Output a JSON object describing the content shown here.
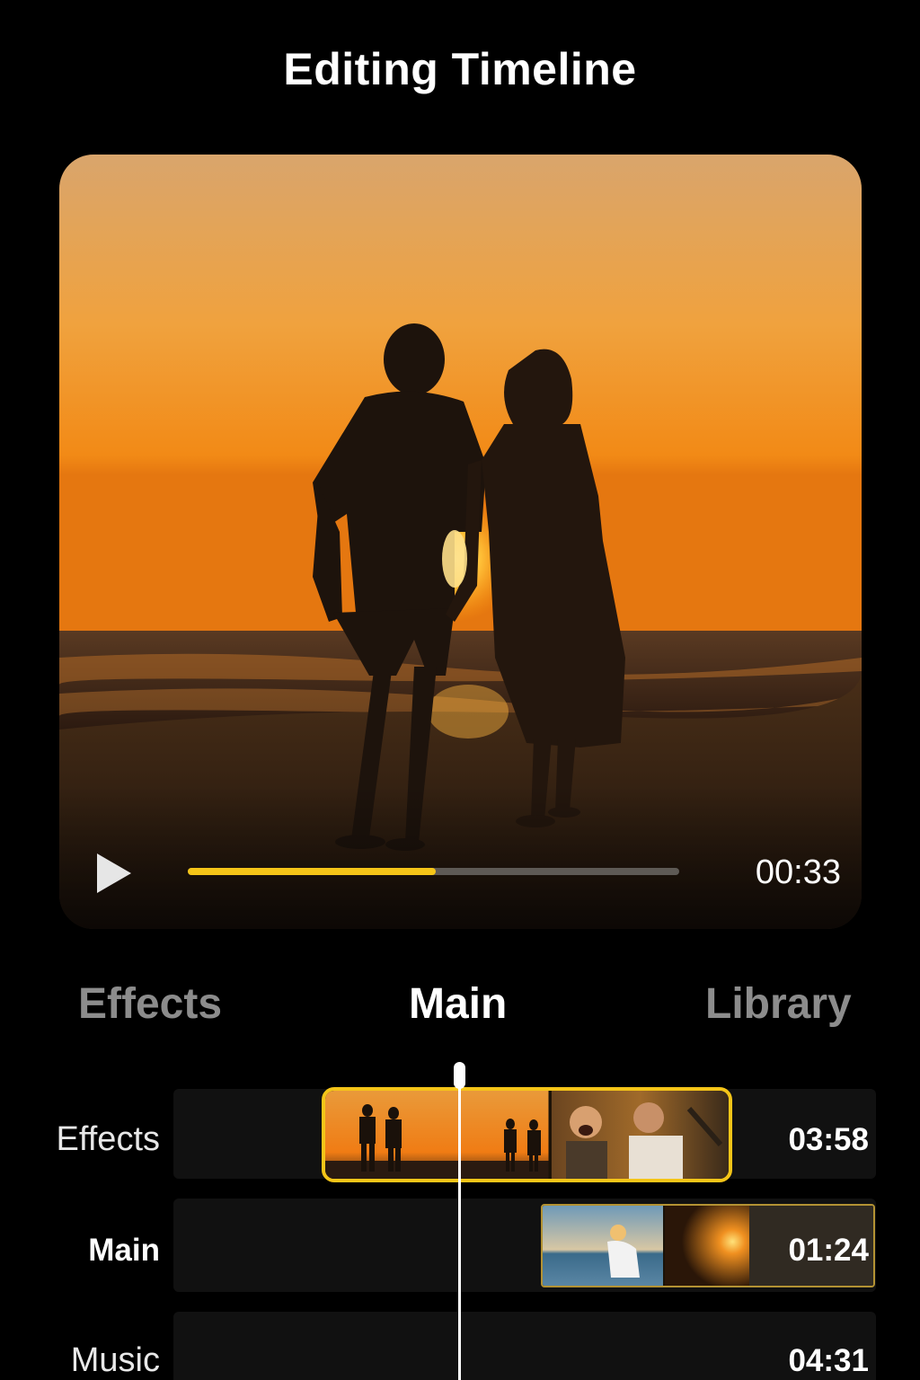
{
  "header": {
    "title": "Editing Timeline"
  },
  "player": {
    "current_time": "00:33",
    "progress": 0.505,
    "progress_color": "#f5c518"
  },
  "tabs": [
    {
      "label": "Effects",
      "active": false
    },
    {
      "label": "Main",
      "active": true
    },
    {
      "label": "Library",
      "active": false
    }
  ],
  "timeline": {
    "tracks": [
      {
        "label": "Effects",
        "duration": "03:58",
        "bold": false
      },
      {
        "label": "Main",
        "duration": "01:24",
        "bold": true
      },
      {
        "label": "Music",
        "duration": "04:31",
        "bold": false
      }
    ]
  },
  "colors": {
    "accent": "#f5c518",
    "background": "#000000"
  },
  "icons": {
    "play": "play-icon"
  }
}
